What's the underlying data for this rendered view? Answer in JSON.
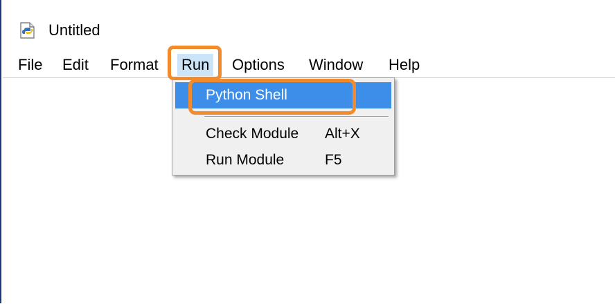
{
  "window": {
    "title": "Untitled",
    "icon": "python-file-icon"
  },
  "menubar": {
    "items": [
      {
        "label": "File"
      },
      {
        "label": "Edit"
      },
      {
        "label": "Format"
      },
      {
        "label": "Run"
      },
      {
        "label": "Options"
      },
      {
        "label": "Window"
      },
      {
        "label": "Help"
      }
    ],
    "active": "Run"
  },
  "run_menu": {
    "items": [
      {
        "label": "Python Shell",
        "accelerator": "",
        "highlighted": true
      },
      {
        "label": "Check Module",
        "accelerator": "Alt+X"
      },
      {
        "label": "Run Module",
        "accelerator": "F5"
      }
    ]
  },
  "colors": {
    "highlight_outline": "#f28a2e",
    "menu_selection": "#3d8ee8",
    "window_border": "#1a3a78"
  }
}
